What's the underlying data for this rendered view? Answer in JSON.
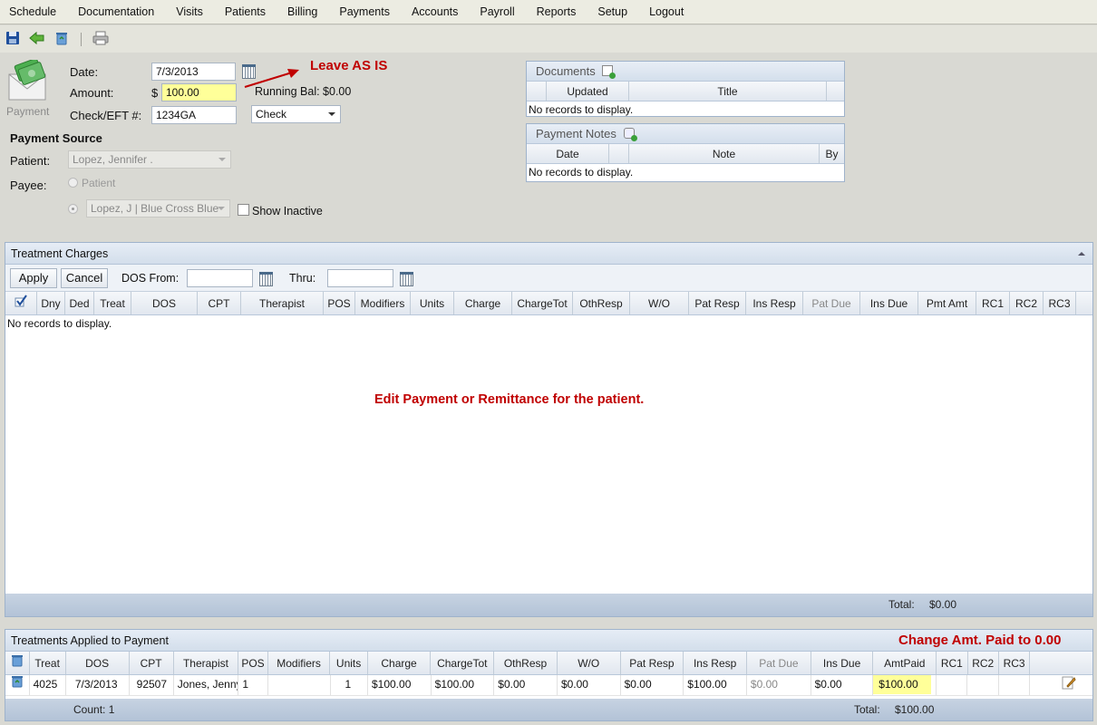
{
  "menu": [
    "Schedule",
    "Documentation",
    "Visits",
    "Patients",
    "Billing",
    "Payments",
    "Accounts",
    "Payroll",
    "Reports",
    "Setup",
    "Logout"
  ],
  "toolbar": {
    "icons": [
      "save-icon",
      "back-arrow-icon",
      "recycle-icon",
      "print-icon"
    ]
  },
  "payment_icon_label": "Payment",
  "form": {
    "date_label": "Date:",
    "date_value": "7/3/2013",
    "amount_label": "Amount:",
    "currency": "$",
    "amount_value": "100.00",
    "running_bal": "Running Bal: $0.00",
    "check_label": "Check/EFT #:",
    "check_value": "1234GA",
    "method_value": "Check",
    "source_heading": "Payment Source",
    "patient_label": "Patient:",
    "patient_value": "Lopez, Jennifer  .",
    "payee_label": "Payee:",
    "payee_radio_patient": "Patient",
    "payee_value": "Lopez, J | Blue Cross Blue",
    "show_inactive": "Show Inactive"
  },
  "annotations": {
    "leave_as_is": "Leave AS IS",
    "edit_payment": "Edit Payment or Remittance for the patient.",
    "change_amt": "Change Amt. Paid to 0.00"
  },
  "documents": {
    "title": "Documents",
    "columns": [
      "Updated",
      "Title"
    ],
    "empty": "No records to display."
  },
  "payment_notes": {
    "title": "Payment Notes",
    "columns": [
      "Date",
      "Note",
      "By"
    ],
    "empty": "No records to display."
  },
  "treatment_charges": {
    "title": "Treatment Charges",
    "apply": "Apply",
    "cancel": "Cancel",
    "dos_from": "DOS From:",
    "thru": "Thru:",
    "columns": [
      "Dny",
      "Ded",
      "Treat",
      "DOS",
      "CPT",
      "Therapist",
      "POS",
      "Modifiers",
      "Units",
      "Charge",
      "ChargeTot",
      "OthResp",
      "W/O",
      "Pat Resp",
      "Ins Resp",
      "Pat Due",
      "Ins Due",
      "Pmt Amt",
      "RC1",
      "RC2",
      "RC3"
    ],
    "empty": "No records to display.",
    "total_label": "Total:",
    "total_value": "$0.00"
  },
  "applied": {
    "title": "Treatments Applied to Payment",
    "columns": [
      "Treat",
      "DOS",
      "CPT",
      "Therapist",
      "POS",
      "Modifiers",
      "Units",
      "Charge",
      "ChargeTot",
      "OthResp",
      "W/O",
      "Pat Resp",
      "Ins Resp",
      "Pat Due",
      "Ins Due",
      "AmtPaid",
      "RC1",
      "RC2",
      "RC3"
    ],
    "row": {
      "treat": "4025",
      "dos": "7/3/2013",
      "cpt": "92507",
      "therapist": "Jones, Jenny",
      "pos": "1",
      "modifiers": "",
      "units": "1",
      "charge": "$100.00",
      "chargetot": "$100.00",
      "othresp": "$0.00",
      "wo": "$0.00",
      "patresp": "$0.00",
      "insresp": "$100.00",
      "patdue": "$0.00",
      "insdue": "$0.00",
      "amtpaid": "$100.00",
      "rc1": "",
      "rc2": "",
      "rc3": ""
    },
    "count": "Count: 1",
    "total_label": "Total:",
    "total_value": "$100.00"
  },
  "colors": {
    "highlight": "#ffff99",
    "annotation": "#c00000",
    "panel_border": "#9fb3cb"
  }
}
